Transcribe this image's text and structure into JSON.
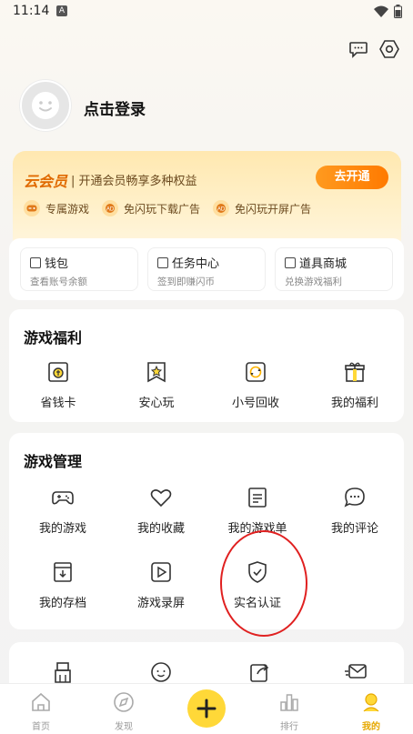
{
  "status": {
    "time": "11:14",
    "notif": "A"
  },
  "header": {
    "login_text": "点击登录",
    "message_icon": "chat-bubble-icon",
    "settings_icon": "settings-hex-icon"
  },
  "vip": {
    "logo": "云会员",
    "desc": "| 开通会员畅享多种权益",
    "button": "去开通",
    "perks": [
      {
        "label": "专属游戏"
      },
      {
        "label": "免闪玩下载广告"
      },
      {
        "label": "免闪玩开屏广告"
      }
    ]
  },
  "quick": [
    {
      "title": "钱包",
      "sub": "查看账号余额"
    },
    {
      "title": "任务中心",
      "sub": "签到即赚闪币"
    },
    {
      "title": "道具商城",
      "sub": "兑换游戏福利"
    }
  ],
  "welfare": {
    "title": "游戏福利",
    "items": [
      {
        "label": "省钱卡"
      },
      {
        "label": "安心玩"
      },
      {
        "label": "小号回收"
      },
      {
        "label": "我的福利"
      }
    ]
  },
  "manage": {
    "title": "游戏管理",
    "items": [
      {
        "label": "我的游戏"
      },
      {
        "label": "我的收藏"
      },
      {
        "label": "我的游戏单"
      },
      {
        "label": "我的评论"
      },
      {
        "label": "我的存档"
      },
      {
        "label": "游戏录屏"
      },
      {
        "label": "实名认证"
      }
    ]
  },
  "tabs": [
    {
      "label": "首页"
    },
    {
      "label": "发现"
    },
    {
      "label": "排行"
    },
    {
      "label": "我的"
    }
  ],
  "colors": {
    "accent": "#ffd838",
    "vip_orange": "#ff7a00",
    "highlight_circle": "#e02020"
  }
}
